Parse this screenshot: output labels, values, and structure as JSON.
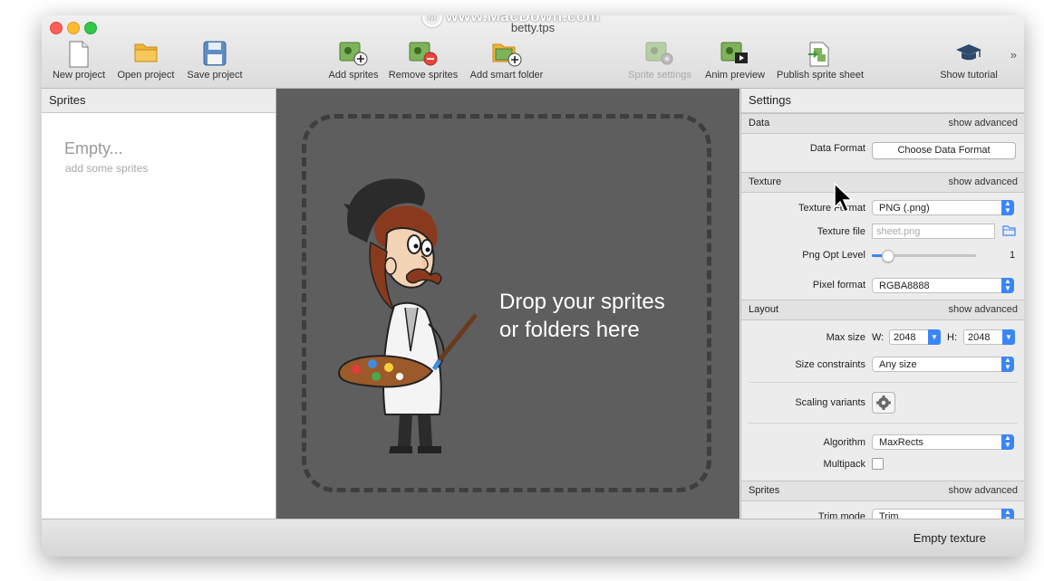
{
  "watermark": "www.MacDown.com",
  "window": {
    "title": "betty.tps"
  },
  "toolbar": {
    "new_project": "New project",
    "open_project": "Open project",
    "save_project": "Save project",
    "add_sprites": "Add sprites",
    "remove_sprites": "Remove sprites",
    "add_smart_folder": "Add smart folder",
    "sprite_settings": "Sprite settings",
    "anim_preview": "Anim preview",
    "publish_sprite_sheet": "Publish sprite sheet",
    "show_tutorial": "Show tutorial",
    "overflow": "»"
  },
  "sprites_panel": {
    "title": "Sprites",
    "empty_title": "Empty...",
    "empty_subtitle": "add some sprites"
  },
  "drop_area": {
    "line1": "Drop your sprites",
    "line2": "or folders here"
  },
  "settings": {
    "title": "Settings",
    "show_advanced": "show advanced",
    "data": {
      "header": "Data",
      "data_format_label": "Data Format",
      "data_format_button": "Choose Data Format"
    },
    "texture": {
      "header": "Texture",
      "texture_format_label": "Texture Format",
      "texture_format_value": "PNG (.png)",
      "texture_file_label": "Texture file",
      "texture_file_placeholder": "sheet.png",
      "png_opt_label": "Png Opt Level",
      "png_opt_value": "1",
      "png_opt_fraction": 0.15,
      "pixel_format_label": "Pixel format",
      "pixel_format_value": "RGBA8888"
    },
    "layout": {
      "header": "Layout",
      "max_size_label": "Max size",
      "w_label": "W:",
      "w_value": "2048",
      "h_label": "H:",
      "h_value": "2048",
      "size_constraints_label": "Size constraints",
      "size_constraints_value": "Any size",
      "scaling_variants_label": "Scaling variants",
      "algorithm_label": "Algorithm",
      "algorithm_value": "MaxRects",
      "multipack_label": "Multipack"
    },
    "sprites": {
      "header": "Sprites",
      "trim_mode_label": "Trim mode",
      "trim_mode_value": "Trim"
    }
  },
  "status": {
    "text": "Empty texture"
  },
  "colors": {
    "accent": "#3b86f7",
    "canvas": "#5e5e5e"
  }
}
